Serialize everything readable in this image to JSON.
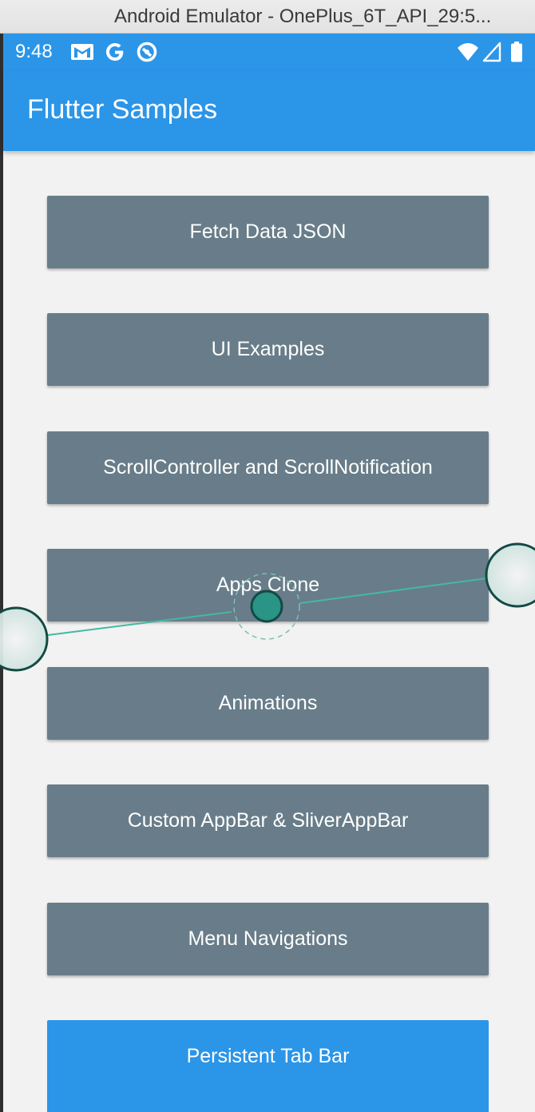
{
  "window": {
    "title": "Android Emulator - OnePlus_6T_API_29:5..."
  },
  "status_bar": {
    "time": "9:48",
    "left_icons": [
      "gmail-icon",
      "google-icon",
      "vpn-icon"
    ],
    "right_icons": [
      "wifi-icon",
      "signal-icon",
      "battery-icon"
    ]
  },
  "app_bar": {
    "title": "Flutter Samples",
    "color": "#2b95e8"
  },
  "buttons": [
    {
      "label": "Fetch Data JSON"
    },
    {
      "label": "UI Examples"
    },
    {
      "label": "ScrollController and ScrollNotification"
    },
    {
      "label": "Apps Clone"
    },
    {
      "label": "Animations"
    },
    {
      "label": "Custom AppBar & SliverAppBar"
    },
    {
      "label": "Menu Navigations"
    },
    {
      "label": "Persistent Tab Bar"
    }
  ],
  "colors": {
    "button_bg": "#687d89",
    "button_primary_bg": "#2b95e8",
    "page_bg": "#f2f2f2",
    "touch_indicator": "#2a9486"
  },
  "overlay": {
    "type": "multi-touch-pinch-indicator"
  }
}
